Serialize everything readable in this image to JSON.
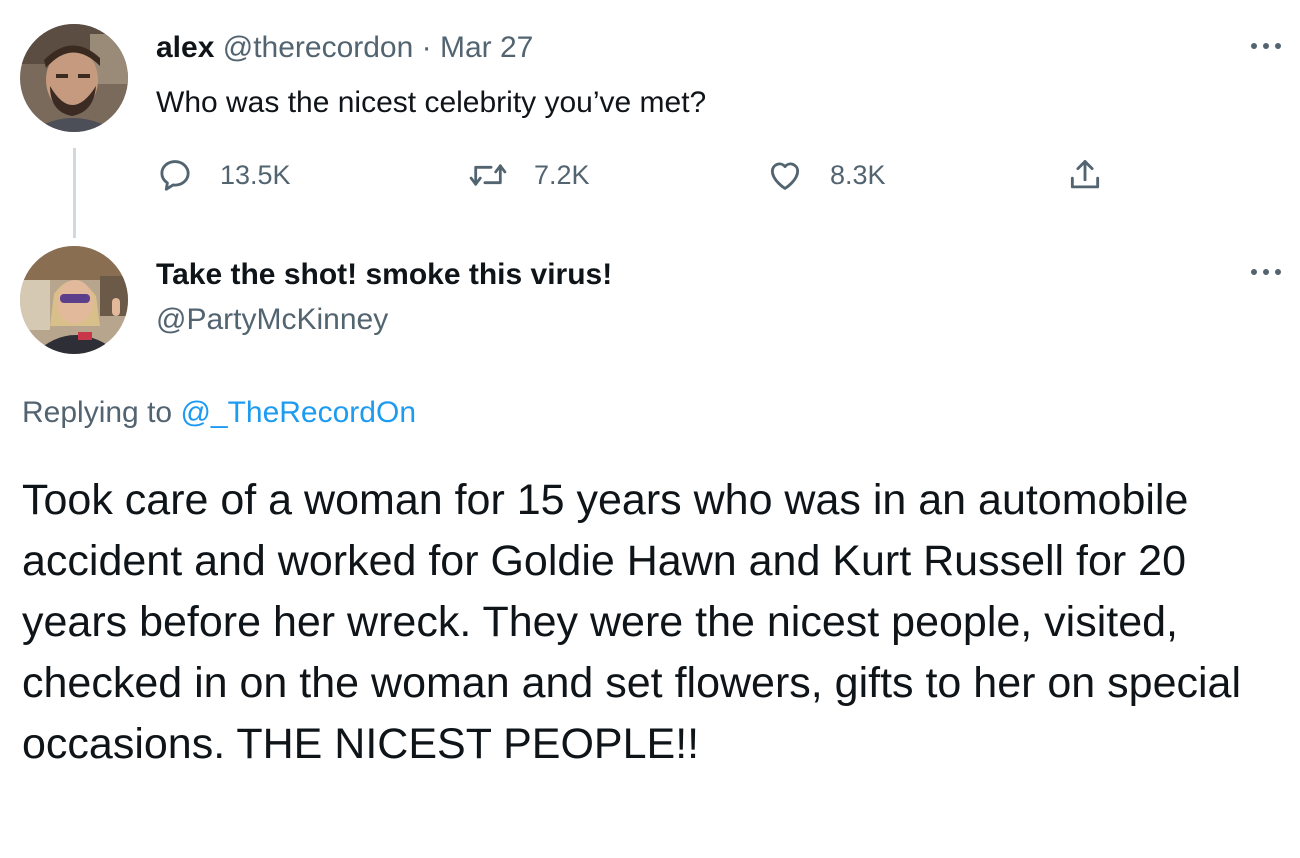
{
  "tweet": {
    "display_name": "alex",
    "handle": "@therecordon",
    "separator": "·",
    "date": "Mar 27",
    "text": "Who was the nicest celebrity you’ve met?",
    "actions": {
      "reply_count": "13.5K",
      "retweet_count": "7.2K",
      "like_count": "8.3K"
    }
  },
  "reply": {
    "display_name": "Take the shot! smoke this virus!",
    "handle": "@PartyMcKinney",
    "replying_prefix": "Replying to",
    "replying_to": "@_TheRecordOn",
    "text": "Took care of a woman for 15 years who was in an automobile accident and worked for Goldie Hawn and Kurt Russell for 20 years before her wreck. They were the nicest people, visited, checked in on the woman and set flowers, gifts to her on special occasions. THE NICEST PEOPLE!!"
  },
  "icons": {
    "reply": "reply-icon",
    "retweet": "retweet-icon",
    "like": "heart-icon",
    "share": "share-icon",
    "more": "more-icon"
  },
  "colors": {
    "text": "#0f1419",
    "secondary": "#536471",
    "link": "#1d9bf0",
    "thread_line": "#cfd9de"
  }
}
